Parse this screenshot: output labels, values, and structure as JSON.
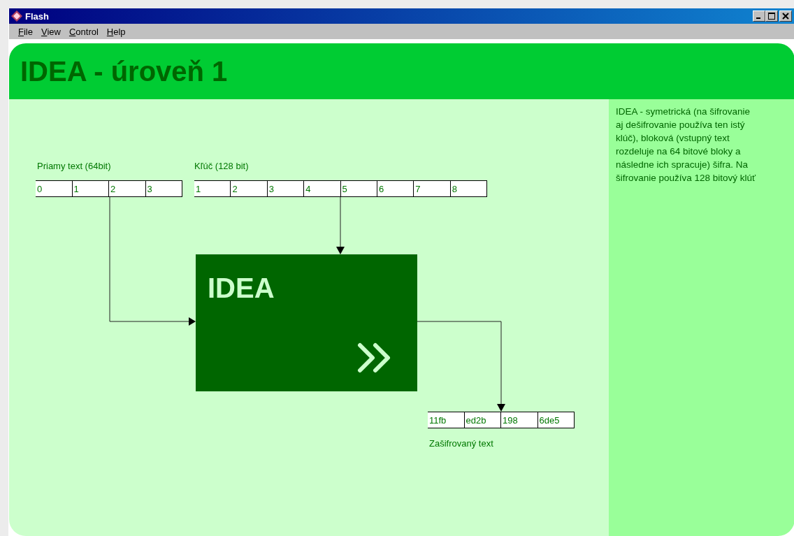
{
  "window": {
    "title": "Flash"
  },
  "menu": [
    {
      "label": "File"
    },
    {
      "label": "View"
    },
    {
      "label": "Control"
    },
    {
      "label": "Help"
    }
  ],
  "heading": "IDEA - úroveň 1",
  "plaintext": {
    "label": "Priamy text (64bit)",
    "cells": [
      "0",
      "1",
      "2",
      "3"
    ]
  },
  "key": {
    "label": "Kľúč (128 bit)",
    "cells": [
      "1",
      "2",
      "3",
      "4",
      "5",
      "6",
      "7",
      "8"
    ]
  },
  "cipher_block": {
    "label": "IDEA"
  },
  "ciphertext": {
    "label": "Zašifrovaný text",
    "cells": [
      "11fb",
      "ed2b",
      "198",
      "6de5"
    ]
  },
  "description": "IDEA - symetrická (na šifrovanie aj dešifrovanie používa ten istý klúč), bloková (vstupný text rozdeluje na 64 bitové bloky a následne ich spracuje) šifra. Na šifrovanie používa 128 bitový klúť"
}
